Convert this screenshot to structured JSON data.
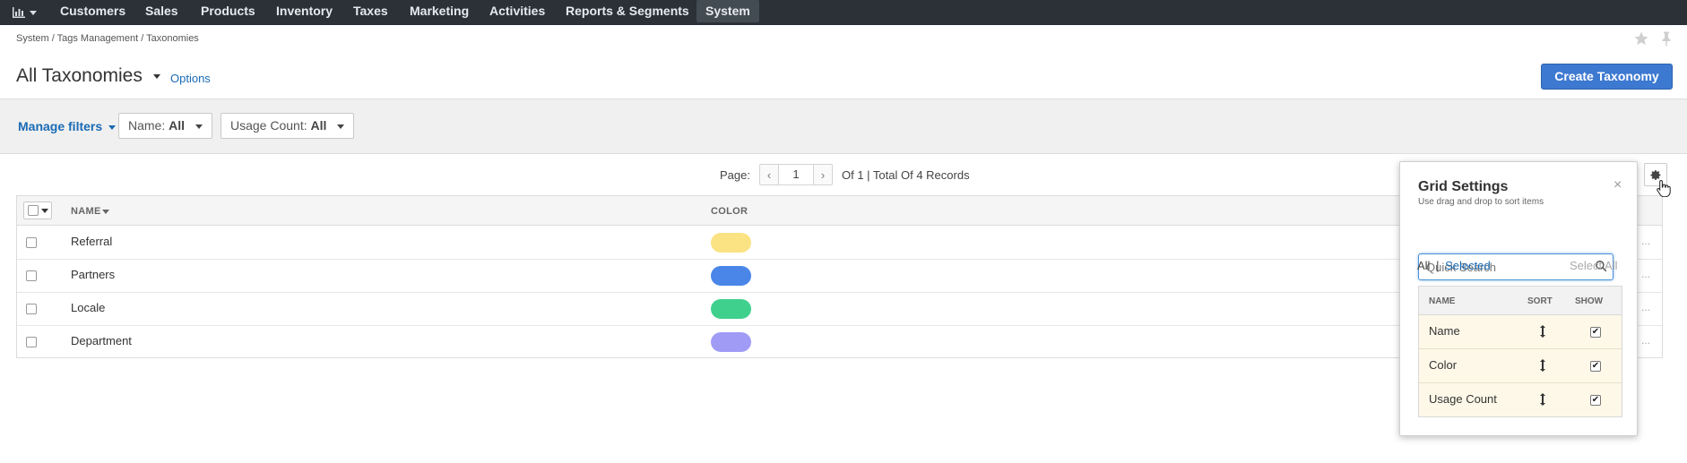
{
  "nav": {
    "dashboard_icon": "bar-chart-icon",
    "items": [
      "Customers",
      "Sales",
      "Products",
      "Inventory",
      "Taxes",
      "Marketing",
      "Activities",
      "Reports & Segments",
      "System"
    ],
    "active": "System"
  },
  "breadcrumb": "System / Tags Management / Taxonomies",
  "header": {
    "title": "All Taxonomies",
    "options_label": "Options",
    "create_button": "Create Taxonomy"
  },
  "filters": {
    "manage_label": "Manage filters",
    "name_label": "Name:",
    "name_value": "All",
    "usage_label": "Usage Count:",
    "usage_value": "All"
  },
  "pager": {
    "page_label": "Page:",
    "page_value": "1",
    "summary": "Of 1 | Total Of 4 Records"
  },
  "grid": {
    "columns": [
      "NAME",
      "COLOR"
    ],
    "rows": [
      {
        "name": "Referral",
        "color": "#fbe384"
      },
      {
        "name": "Partners",
        "color": "#4a86e8"
      },
      {
        "name": "Locale",
        "color": "#40d08e"
      },
      {
        "name": "Department",
        "color": "#a09cf6"
      }
    ]
  },
  "grid_settings": {
    "title": "Grid Settings",
    "subtitle": "Use drag and drop to sort items",
    "search_placeholder": "Quick Search",
    "scope_all": "All",
    "scope_sep": "|",
    "scope_selected": "Selected",
    "select_all": "Select All",
    "columns": [
      "NAME",
      "SORT",
      "SHOW"
    ],
    "items": [
      {
        "name": "Name",
        "show": true
      },
      {
        "name": "Color",
        "show": true
      },
      {
        "name": "Usage Count",
        "show": true
      }
    ]
  },
  "colors": {
    "topnav_bg": "#2b3137",
    "accent_blue": "#3d79d1",
    "link_blue": "#1a6bb5"
  }
}
